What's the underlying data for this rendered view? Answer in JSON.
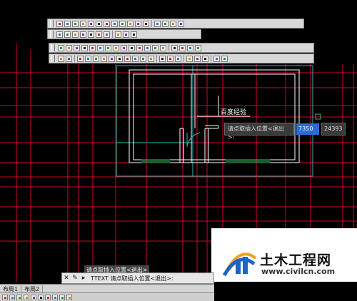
{
  "drawing": {
    "annotation_text": "百度经验"
  },
  "tooltip": {
    "prompt": "请点取插入位置<退出>:",
    "x_value": "7350",
    "y_value": "24393"
  },
  "command": {
    "history": "请点取插入位置<退出>",
    "input": "TTEXT 请点取插入位置<退出>:"
  },
  "layout_tabs": [
    "布局1",
    "布局2"
  ],
  "watermark": {
    "cn": "土木工程网",
    "en": "www.civilcn.com"
  },
  "toolbars": [
    {
      "icons": [
        "grid-icon",
        "connect-icon",
        "move-icon",
        "text-icon",
        "table-icon",
        "node-icon",
        "measure-icon",
        "arrow-icon",
        "curve-icon",
        "rotate-icon",
        "dim-icon",
        "cross-icon",
        "sep",
        "plus-icon",
        "compass-icon",
        "refresh-icon",
        "blue-icon"
      ]
    },
    {
      "icons": [
        "copy-icon",
        "link-icon",
        "square-icon",
        "box-icon",
        "block-icon",
        "layer-icon",
        "hatch-icon",
        "sep",
        "column-icon",
        "wall-icon",
        "door-icon"
      ]
    },
    {
      "icons": [
        "layers-icon",
        "tree-icon",
        "grid-icon",
        "arrow-icon",
        "move-icon",
        "text-icon",
        "flag-icon",
        "axis-icon",
        "dim-icon",
        "warn-icon",
        "scale-icon",
        "table-icon",
        "align-icon",
        "pencil-icon",
        "sep",
        "filter-icon",
        "type-icon",
        "zoom-icon",
        "help-icon"
      ]
    },
    {
      "icons": [
        "stair-icon",
        "find-icon",
        "sep",
        "block-icon",
        "pattern-icon",
        "curve-icon",
        "point-icon",
        "lock-icon",
        "layer-icon",
        "box-icon",
        "chart-icon",
        "folder-icon",
        "image-icon",
        "sep",
        "paint-icon",
        "note-icon",
        "drop-icon",
        "sep",
        "view-icon",
        "print-icon",
        "door-icon",
        "sep",
        "list-icon",
        "grid-icon"
      ]
    }
  ],
  "colors": {
    "axis_red": "#d0002a",
    "frame_cyan": "#35b5b5",
    "wall_white": "#ffffff",
    "watermark_blue": "#1e63c8",
    "watermark_orange": "#f0a020"
  }
}
